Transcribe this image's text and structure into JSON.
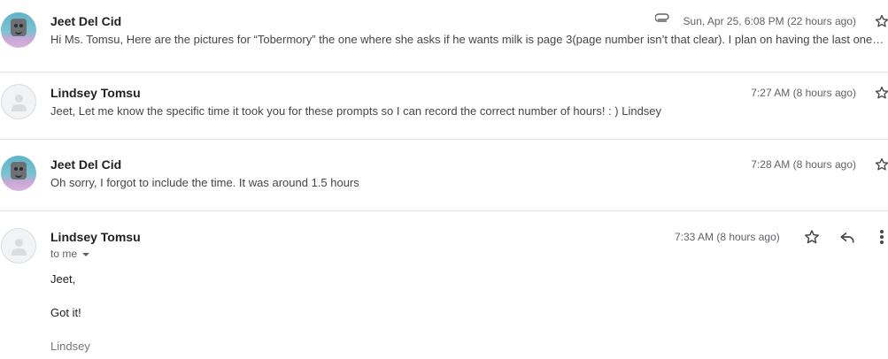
{
  "messages": [
    {
      "sender": "Jeet Del Cid",
      "timestamp": "Sun, Apr 25, 6:08 PM (22 hours ago)",
      "has_attachment": true,
      "snippet": "Hi Ms. Tomsu, Here are the pictures for “Tobermory” the one where she asks if he wants milk is page 3(page number isn’t that clear). I plan on having the last ones done by tonight",
      "avatar": "photo-avatar"
    },
    {
      "sender": "Lindsey Tomsu",
      "timestamp": "7:27 AM (8 hours ago)",
      "snippet": "Jeet, Let me know the specific time it took you for these prompts so I can record the correct number of hours! : ) Lindsey",
      "avatar": "default-avatar"
    },
    {
      "sender": "Jeet Del Cid",
      "timestamp": "7:28 AM (8 hours ago)",
      "snippet": "Oh sorry, I forgot to include the time. It was around 1.5 hours",
      "avatar": "photo-avatar"
    }
  ],
  "open_message": {
    "sender": "Lindsey Tomsu",
    "timestamp": "7:33 AM (8 hours ago)",
    "recipient": "to me",
    "body": {
      "greeting": "Jeet,",
      "text": "Got it!",
      "signature": "Lindsey"
    },
    "avatar": "default-avatar"
  },
  "icons": {
    "star": "star-icon",
    "reply": "reply-icon",
    "more": "more-vert-icon",
    "attachment": "paperclip-icon"
  },
  "colors": {
    "text_primary": "#202124",
    "text_secondary": "#5f6368",
    "divider": "#e0e0e0"
  }
}
